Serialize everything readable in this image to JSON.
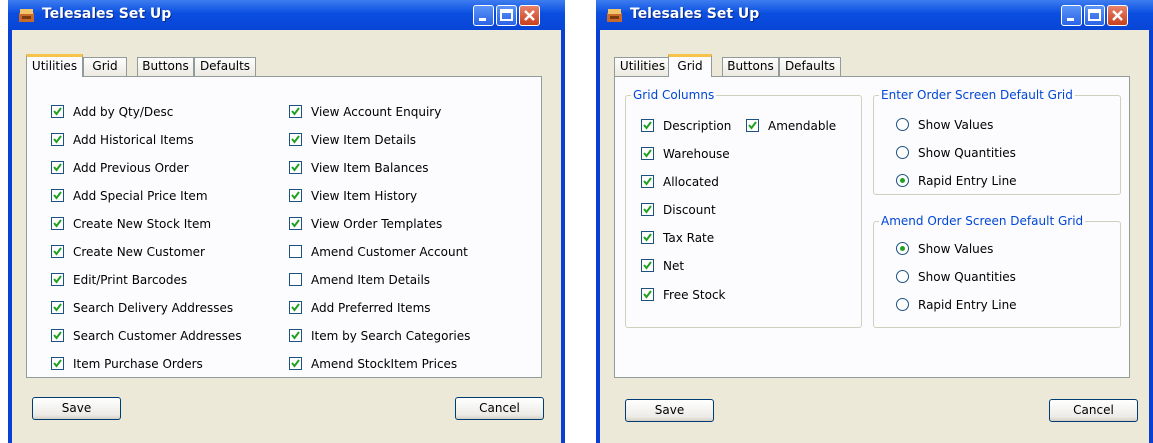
{
  "window1": {
    "title": "Telesales Set Up",
    "tabs": [
      "Utilities",
      "Grid",
      "Buttons",
      "Defaults"
    ],
    "active_tab": "Utilities",
    "utilities": {
      "left_column": [
        {
          "label": "Add by Qty/Desc",
          "checked": true
        },
        {
          "label": "Add Historical Items",
          "checked": true
        },
        {
          "label": "Add Previous Order",
          "checked": true
        },
        {
          "label": "Add Special Price Item",
          "checked": true
        },
        {
          "label": "Create New Stock Item",
          "checked": true
        },
        {
          "label": "Create New Customer",
          "checked": true
        },
        {
          "label": "Edit/Print Barcodes",
          "checked": true
        },
        {
          "label": "Search Delivery Addresses",
          "checked": true
        },
        {
          "label": "Search Customer Addresses",
          "checked": true
        },
        {
          "label": "Item Purchase Orders",
          "checked": true
        }
      ],
      "right_column": [
        {
          "label": "View Account Enquiry",
          "checked": true
        },
        {
          "label": "View Item Details",
          "checked": true
        },
        {
          "label": "View Item Balances",
          "checked": true
        },
        {
          "label": "View Item History",
          "checked": true
        },
        {
          "label": "View Order Templates",
          "checked": true
        },
        {
          "label": "Amend Customer Account",
          "checked": false
        },
        {
          "label": "Amend Item Details",
          "checked": false
        },
        {
          "label": "Add Preferred Items",
          "checked": true
        },
        {
          "label": "Item by Search Categories",
          "checked": true
        },
        {
          "label": "Amend StockItem Prices",
          "checked": true
        }
      ]
    },
    "save_label": "Save",
    "cancel_label": "Cancel"
  },
  "window2": {
    "title": "Telesales Set Up",
    "tabs": [
      "Utilities",
      "Grid",
      "Buttons",
      "Defaults"
    ],
    "active_tab": "Grid",
    "grid_columns": {
      "title": "Grid Columns",
      "items": [
        {
          "label": "Description",
          "checked": true
        },
        {
          "label": "Amendable",
          "checked": true
        },
        {
          "label": "Warehouse",
          "checked": true
        },
        {
          "label": "Allocated",
          "checked": true
        },
        {
          "label": "Discount",
          "checked": true
        },
        {
          "label": "Tax Rate",
          "checked": true
        },
        {
          "label": "Net",
          "checked": true
        },
        {
          "label": "Free Stock",
          "checked": true
        }
      ]
    },
    "enter_order_grid": {
      "title": "Enter Order Screen Default Grid",
      "options": [
        "Show Values",
        "Show Quantities",
        "Rapid Entry Line"
      ],
      "selected": "Rapid Entry Line"
    },
    "amend_order_grid": {
      "title": "Amend Order Screen Default Grid",
      "options": [
        "Show Values",
        "Show Quantities",
        "Rapid Entry Line"
      ],
      "selected": "Show Values"
    },
    "save_label": "Save",
    "cancel_label": "Cancel"
  },
  "colors": {
    "titlebar": "#0a4ee0",
    "dialog_bg": "#ece9d8",
    "tab_highlight": "#f7c24a",
    "check_mark": "#21a121",
    "group_title": "#0046d5"
  },
  "icons": [
    "app-icon",
    "minimize-icon",
    "maximize-icon",
    "close-icon",
    "checkmark-icon",
    "radio-dot-icon"
  ]
}
